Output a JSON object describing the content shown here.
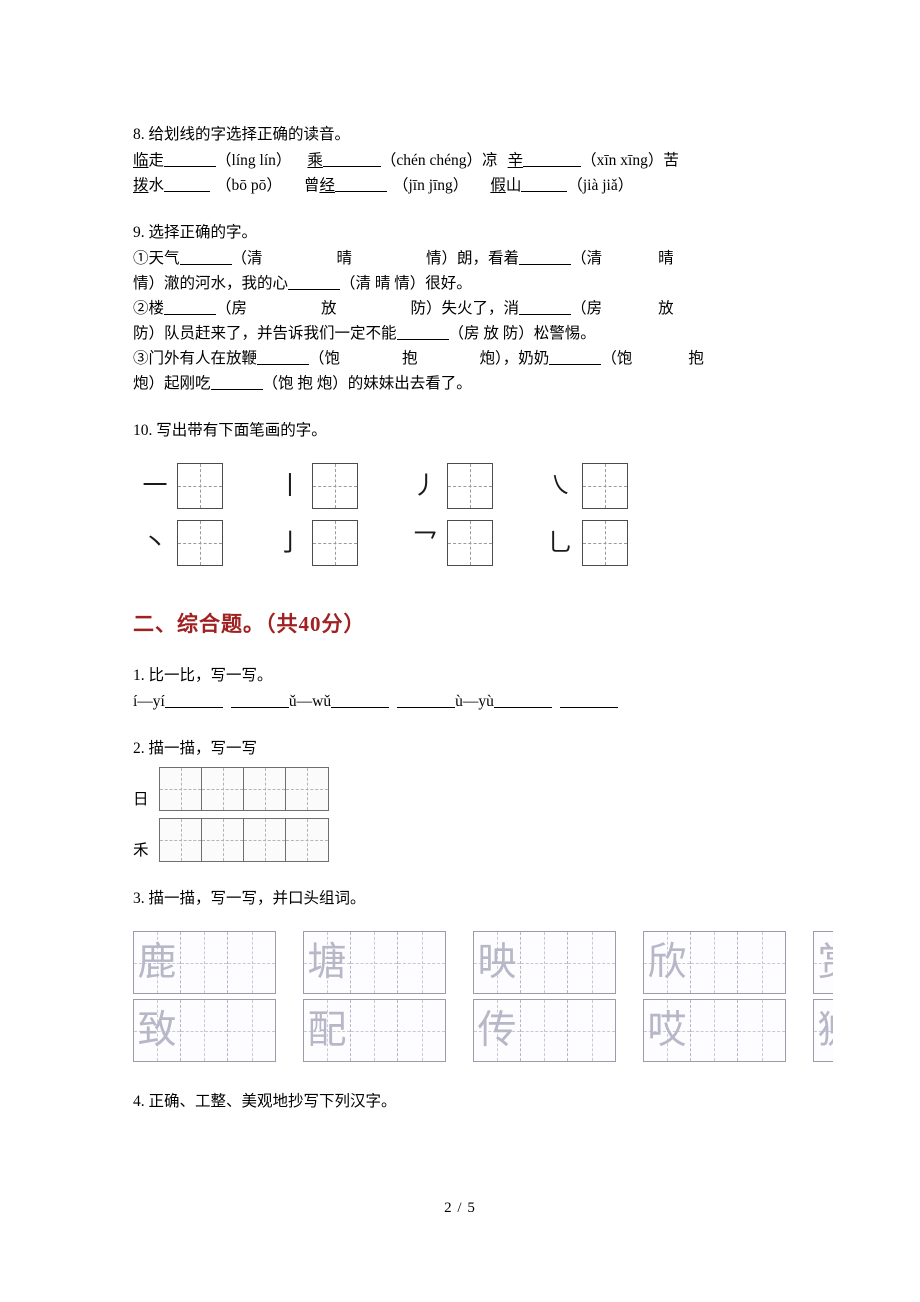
{
  "page": {
    "footer": "2 / 5"
  },
  "q8": {
    "title": "8. 给划线的字选择正确的读音。",
    "line1": {
      "w1_under": "临",
      "w1_rest": "走",
      "w1_opts": "（líng lín）",
      "w2_under": "乘",
      "w2_opts": "（chén chéng）",
      "w3_pre": "凉",
      "w3_under": "辛",
      "w3_opts": "（xīn xīng）",
      "w3_tail": "苦"
    },
    "line2": {
      "w1_under": "拨",
      "w1_rest": "水",
      "w1_opts": "（bō pō）",
      "w2_pre": "曾",
      "w2_under": "经",
      "w2_opts": "（jīn jīng）",
      "w3_under": "假",
      "w3_rest": "山",
      "w3_opts": "（jià jiǎ）"
    }
  },
  "q9": {
    "title": "9. 选择正确的字。",
    "item1_a": "①天气",
    "item1_b": "（清",
    "item1_c": "晴",
    "item1_d": "情）朗，看着",
    "item1_e": "（清",
    "item1_f": "晴",
    "item1_g": "情）澈的河水，我的心",
    "item1_h": "（清 晴 情）很好。",
    "item2_a": "②楼",
    "item2_b": "（房",
    "item2_c": "放",
    "item2_d": "防）失火了，消",
    "item2_e": "（房",
    "item2_f": "放",
    "item2_g": "防）队员赶来了，并告诉我们一定不能",
    "item2_h": "（房 放 防）松警惕。",
    "item3_a": "③门外有人在放鞭",
    "item3_b": "（饱",
    "item3_c": "抱",
    "item3_d": "炮），奶奶",
    "item3_e": "（饱",
    "item3_f": "抱",
    "item3_g": "炮）起刚吃",
    "item3_h": "（饱 抱 炮）的妹妹出去看了。"
  },
  "q10": {
    "title": "10. 写出带有下面笔画的字。",
    "rows": [
      {
        "strokes": [
          "一",
          "丨",
          "丿",
          "㇏"
        ]
      },
      {
        "strokes": [
          "丶",
          "亅",
          "乛",
          "乚"
        ]
      }
    ]
  },
  "section2": {
    "title": "二、综合题。（共40分）"
  },
  "s2q1": {
    "title": "1. 比一比，写一写。",
    "p1": "í—yí",
    "p2": "ǔ—wǔ",
    "p3": "ù—yù"
  },
  "s2q2": {
    "title": "2. 描一描，写一写",
    "rows": [
      {
        "label": "日",
        "cells": 4
      },
      {
        "label": "禾",
        "cells": 4
      }
    ]
  },
  "s2q3": {
    "title": "3. 描一描，写一写，并口头组词。",
    "row1": [
      "鹿",
      "塘",
      "映",
      "欣",
      "赏"
    ],
    "row2": [
      "致",
      "配",
      "传",
      "哎",
      "狮"
    ],
    "cells_per_group": 3
  },
  "s2q4": {
    "title": "4. 正确、工整、美观地抄写下列汉字。"
  }
}
